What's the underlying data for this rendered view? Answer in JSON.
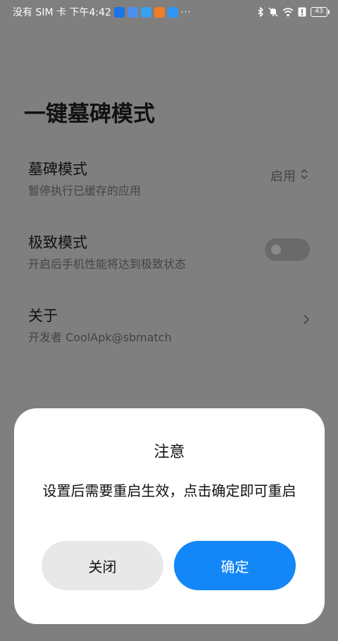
{
  "status_bar": {
    "left_text": "没有 SIM 卡 下午4:42",
    "more": "···",
    "battery": "43"
  },
  "page": {
    "title": "一键墓碑模式"
  },
  "settings": [
    {
      "title": "墓碑模式",
      "subtitle": "暂停执行已缓存的应用",
      "value": "启用"
    },
    {
      "title": "极致模式",
      "subtitle": "开启后手机性能将达到极致状态",
      "toggle_on": false
    },
    {
      "title": "关于",
      "subtitle": "开发者 CoolApk@sbmatch"
    }
  ],
  "dialog": {
    "title": "注意",
    "message": "设置后需要重启生效，点击确定即可重启",
    "cancel_label": "关闭",
    "confirm_label": "确定"
  },
  "colors": {
    "accent": "#1487f8",
    "scrim": "#7f7f7f"
  }
}
